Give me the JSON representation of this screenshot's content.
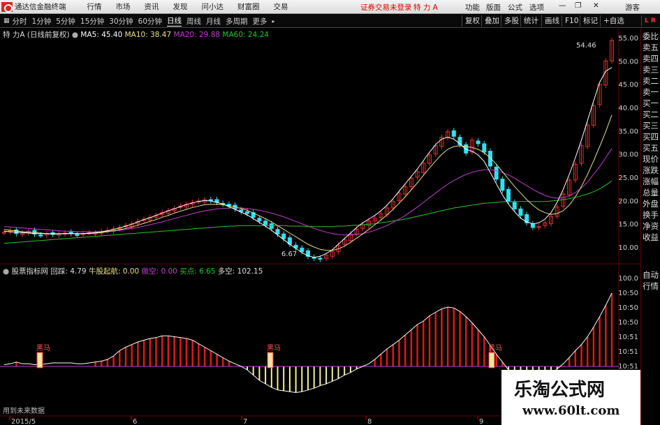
{
  "menu": {
    "app_title": "通达信金融终端",
    "items": [
      "行情",
      "市场",
      "资讯",
      "发现",
      "问小达",
      "财富圈",
      "交易"
    ],
    "login_status": "证券交易未登录",
    "stock_short": "特 力 A",
    "right": [
      "功能",
      "版面",
      "公式",
      "选项",
      "游客"
    ],
    "lr_badge": "L R"
  },
  "tabs": [
    "分时",
    "1分钟",
    "5分钟",
    "15分钟",
    "30分钟",
    "60分钟",
    "日线",
    "周线",
    "月线",
    "多周期",
    "更多"
  ],
  "active_tab": "日线",
  "toolbar_right": [
    "复权",
    "叠加",
    "多股",
    "统计",
    "画线",
    "F10",
    "标记",
    "+自选"
  ],
  "main_legend": {
    "title": "特 力A (日线前复权)",
    "ma5": "MA5: 45.40",
    "ma10": "MA10: 38.47",
    "ma20": "MA20: 29.88",
    "ma60": "MA60: 24.24"
  },
  "main_colors": {
    "ma5": "#ffffff",
    "ma10": "#e6e08a",
    "ma20": "#c040d0",
    "ma60": "#30c030",
    "up": "#e03030",
    "down": "#30e0f0"
  },
  "price_axis": [
    "55.00",
    "50.00",
    "45.00",
    "40.00",
    "35.00",
    "30.00",
    "25.00",
    "20.00",
    "15.00",
    "10.00"
  ],
  "price_annotations": {
    "high": "54.46",
    "low": "6.67"
  },
  "indicator_legend": {
    "name": "股票指标网",
    "v1": "回踩: 4.79",
    "v2": "牛股起航: 0.00",
    "v3": "做空: 0.00",
    "v4": "买点: 6.65",
    "v5": "多空: 102.15"
  },
  "indicator_axis": [
    "100.0",
    "10:50",
    "10:50",
    "10:50",
    "10:51",
    "10:51",
    "10:51"
  ],
  "indicator_markers": [
    "黑马",
    "黑马",
    "黑马"
  ],
  "indicator_note": "用到未来数据",
  "date_axis": [
    "2015/5",
    "6",
    "7",
    "8",
    "9"
  ],
  "right_panel": [
    "委比",
    "卖五",
    "卖四",
    "卖三",
    "卖二",
    "卖一",
    "买一",
    "买二",
    "买三",
    "买四",
    "买五",
    "现价",
    "涨跌",
    "涨幅",
    "总量",
    "外盘",
    "换手",
    "净资",
    "收益"
  ],
  "right_panel2": [
    "自动",
    "行情"
  ],
  "watermark": {
    "title": "乐淘公式网",
    "url": "www.60lt.com"
  },
  "chart_data": {
    "type": "candlestick",
    "price_range": [
      5,
      57
    ],
    "closes": [
      13.2,
      13.5,
      12.9,
      13.0,
      13.4,
      12.8,
      12.6,
      12.9,
      12.7,
      12.8,
      13.0,
      12.9,
      12.7,
      12.9,
      13.1,
      13.0,
      13.3,
      13.6,
      13.9,
      14.2,
      14.6,
      15.0,
      15.5,
      16.0,
      16.4,
      16.8,
      17.4,
      17.8,
      18.3,
      18.8,
      19.2,
      19.6,
      19.9,
      20.2,
      20.0,
      19.6,
      19.2,
      18.8,
      18.2,
      17.6,
      17.2,
      16.4,
      15.6,
      14.8,
      14.0,
      12.8,
      11.8,
      10.6,
      9.8,
      9.0,
      8.0,
      7.6,
      7.4,
      8.2,
      9.0,
      10.4,
      11.6,
      12.8,
      13.8,
      14.8,
      15.6,
      16.2,
      17.2,
      18.4,
      19.8,
      21.6,
      23.0,
      24.8,
      26.2,
      28.0,
      29.8,
      31.8,
      33.6,
      34.8,
      33.8,
      32.0,
      30.2,
      33.0,
      32.2,
      30.4,
      27.4,
      24.6,
      22.2,
      19.8,
      18.2,
      16.8,
      15.2,
      14.2,
      14.4,
      15.2,
      16.6,
      18.6,
      21.4,
      24.4,
      27.8,
      31.8,
      36.2,
      40.4,
      45.0,
      50.0,
      54.4
    ],
    "ma5": [
      13.4,
      13.3,
      13.2,
      13.1,
      13.0,
      12.9,
      12.9,
      12.9,
      12.8,
      12.8,
      12.9,
      12.9,
      12.9,
      12.9,
      13.0,
      13.1,
      13.3,
      13.5,
      13.8,
      14.1,
      14.5,
      14.9,
      15.4,
      15.9,
      16.3,
      16.8,
      17.3,
      17.8,
      18.2,
      18.7,
      19.1,
      19.5,
      19.8,
      20.0,
      19.9,
      19.6,
      19.2,
      18.7,
      18.1,
      17.5,
      16.9,
      16.1,
      15.3,
      14.5,
      13.6,
      12.6,
      11.6,
      10.6,
      9.7,
      8.8,
      8.1,
      7.8,
      8.0,
      8.6,
      9.4,
      10.6,
      11.8,
      13.0,
      14.2,
      15.2,
      16.0,
      16.8,
      17.8,
      19.0,
      20.4,
      22.0,
      23.6,
      25.2,
      26.8,
      28.6,
      30.4,
      32.0,
      33.2,
      33.6,
      33.2,
      32.2,
      31.0,
      30.6,
      29.8,
      28.4,
      26.0,
      23.6,
      21.2,
      19.2,
      17.6,
      16.2,
      15.4,
      15.0,
      15.2,
      16.0,
      17.4,
      19.6,
      22.4,
      25.6,
      29.2,
      33.0,
      37.2,
      41.4,
      45.4,
      47.8,
      48.6
    ],
    "ma10": [
      13.8,
      13.6,
      13.5,
      13.3,
      13.2,
      13.1,
      13.0,
      12.9,
      12.9,
      12.9,
      12.9,
      12.9,
      12.9,
      12.9,
      12.9,
      13.0,
      13.1,
      13.3,
      13.5,
      13.7,
      14.0,
      14.3,
      14.7,
      15.1,
      15.5,
      15.9,
      16.4,
      16.8,
      17.3,
      17.7,
      18.1,
      18.5,
      18.8,
      19.1,
      19.2,
      19.2,
      19.1,
      18.9,
      18.6,
      18.3,
      17.9,
      17.3,
      16.7,
      16.1,
      15.4,
      14.6,
      13.8,
      13.0,
      12.2,
      11.4,
      10.6,
      10.0,
      9.5,
      9.3,
      9.3,
      9.6,
      10.2,
      11.0,
      11.9,
      12.8,
      13.8,
      14.8,
      15.8,
      16.9,
      18.1,
      19.4,
      20.8,
      22.3,
      23.8,
      25.4,
      27.0,
      28.5,
      29.9,
      31.0,
      31.6,
      31.8,
      31.6,
      31.4,
      31.0,
      30.3,
      29.2,
      27.8,
      26.2,
      24.6,
      23.0,
      21.6,
      20.2,
      19.0,
      18.0,
      17.4,
      17.0,
      17.2,
      17.8,
      19.0,
      20.8,
      23.0,
      25.6,
      28.5,
      31.6,
      34.8,
      38.4
    ],
    "ma20": [
      14.4,
      14.3,
      14.2,
      14.1,
      14.0,
      13.9,
      13.8,
      13.7,
      13.6,
      13.5,
      13.4,
      13.4,
      13.3,
      13.3,
      13.3,
      13.3,
      13.3,
      13.4,
      13.5,
      13.6,
      13.8,
      14.0,
      14.2,
      14.5,
      14.8,
      15.1,
      15.4,
      15.8,
      16.1,
      16.5,
      16.8,
      17.2,
      17.5,
      17.8,
      18.0,
      18.2,
      18.3,
      18.4,
      18.4,
      18.4,
      18.3,
      18.1,
      17.9,
      17.6,
      17.3,
      16.9,
      16.5,
      16.0,
      15.5,
      15.0,
      14.5,
      14.0,
      13.6,
      13.2,
      12.9,
      12.7,
      12.6,
      12.6,
      12.7,
      12.9,
      13.2,
      13.6,
      14.1,
      14.6,
      15.3,
      16.0,
      16.8,
      17.7,
      18.6,
      19.6,
      20.6,
      21.6,
      22.6,
      23.5,
      24.3,
      25.0,
      25.6,
      26.1,
      26.4,
      26.6,
      26.6,
      26.4,
      26.0,
      25.5,
      24.8,
      24.0,
      23.2,
      22.4,
      21.7,
      21.1,
      20.7,
      20.5,
      20.6,
      21.0,
      21.7,
      22.7,
      24.0,
      25.6,
      27.3,
      29.2,
      31.2
    ],
    "ma60": [
      10.8,
      10.9,
      11.0,
      11.1,
      11.2,
      11.3,
      11.4,
      11.5,
      11.6,
      11.7,
      11.8,
      11.9,
      12.0,
      12.1,
      12.2,
      12.3,
      12.4,
      12.5,
      12.6,
      12.7,
      12.8,
      12.9,
      13.0,
      13.1,
      13.2,
      13.3,
      13.4,
      13.5,
      13.6,
      13.7,
      13.8,
      13.9,
      14.0,
      14.1,
      14.2,
      14.3,
      14.4,
      14.5,
      14.5,
      14.6,
      14.6,
      14.6,
      14.6,
      14.6,
      14.6,
      14.6,
      14.6,
      14.5,
      14.5,
      14.5,
      14.4,
      14.4,
      14.4,
      14.4,
      14.4,
      14.5,
      14.5,
      14.6,
      14.7,
      14.8,
      14.9,
      15.0,
      15.2,
      15.4,
      15.6,
      15.8,
      16.0,
      16.3,
      16.6,
      16.9,
      17.2,
      17.5,
      17.8,
      18.1,
      18.4,
      18.6,
      18.8,
      19.0,
      19.2,
      19.4,
      19.5,
      19.6,
      19.7,
      19.8,
      19.8,
      19.8,
      19.8,
      19.8,
      19.8,
      19.8,
      19.9,
      20.0,
      20.2,
      20.4,
      20.7,
      21.0,
      21.4,
      21.9,
      22.5,
      23.3,
      24.2
    ],
    "indicator": [
      2,
      3,
      5,
      3,
      3,
      2,
      2,
      3,
      4,
      4,
      4,
      4,
      3,
      3,
      4,
      5,
      6,
      8,
      12,
      18,
      22,
      25,
      28,
      30,
      32,
      33,
      35,
      35,
      34,
      33,
      32,
      30,
      26,
      22,
      18,
      14,
      10,
      6,
      3,
      0,
      -4,
      -10,
      -16,
      -20,
      -24,
      -27,
      -28,
      -29,
      -30,
      -29,
      -27,
      -25,
      -22,
      -20,
      -17,
      -14,
      -10,
      -7,
      -3,
      0,
      3,
      8,
      14,
      20,
      25,
      30,
      36,
      42,
      48,
      52,
      58,
      62,
      66,
      68,
      67,
      63,
      57,
      50,
      42,
      34,
      24,
      14,
      5,
      -4,
      -10,
      -14,
      -16,
      -16,
      -15,
      -12,
      -8,
      -3,
      3,
      10,
      18,
      25,
      34,
      45,
      57,
      70,
      84
    ]
  }
}
